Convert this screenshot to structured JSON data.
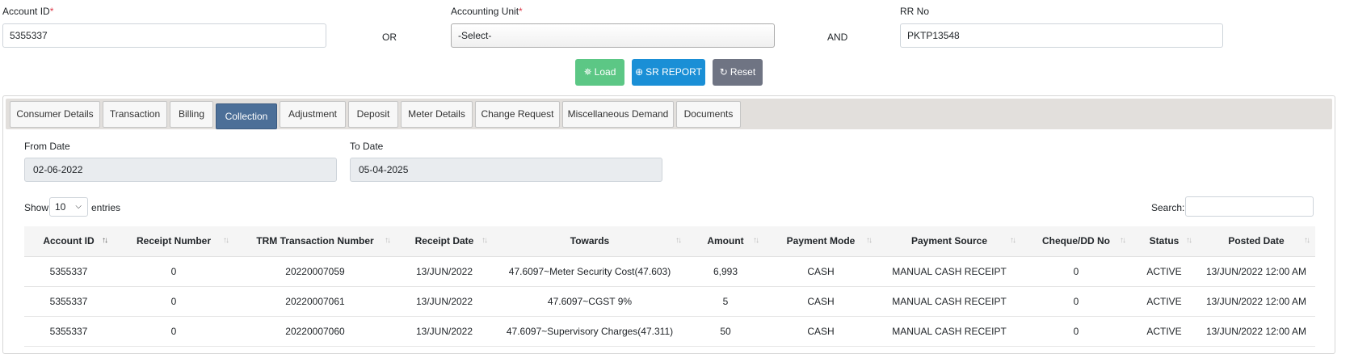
{
  "filters": {
    "account_id_label": "Account ID",
    "account_id_value": "5355337",
    "or_label": "OR",
    "accounting_unit_label": "Accounting Unit",
    "accounting_unit_value": "-Select-",
    "and_label": "AND",
    "rr_no_label": "RR No",
    "rr_no_value": "PKTP13548",
    "required_mark": "*"
  },
  "buttons": {
    "load": "Load",
    "sr_report": "SR REPORT",
    "reset": "Reset"
  },
  "tabs": [
    {
      "label": "Consumer Details"
    },
    {
      "label": "Transaction"
    },
    {
      "label": "Billing"
    },
    {
      "label": "Collection"
    },
    {
      "label": "Adjustment"
    },
    {
      "label": "Deposit"
    },
    {
      "label": "Meter Details"
    },
    {
      "label": "Change Request"
    },
    {
      "label": "Miscellaneous Demand"
    },
    {
      "label": "Documents"
    }
  ],
  "active_tab": "Collection",
  "dates": {
    "from_label": "From Date",
    "from_value": "02-06-2022",
    "to_label": "To Date",
    "to_value": "05-04-2025"
  },
  "table_controls": {
    "show_label": "Show",
    "entries_value": "10",
    "entries_label": "entries",
    "search_label": "Search:"
  },
  "table": {
    "columns": [
      "Account ID",
      "Receipt Number",
      "TRM Transaction Number",
      "Receipt Date",
      "Towards",
      "Amount",
      "Payment Mode",
      "Payment Source",
      "Cheque/DD No",
      "Status",
      "Posted Date"
    ],
    "rows": [
      [
        "5355337",
        "0",
        "20220007059",
        "13/JUN/2022",
        "47.6097~Meter Security Cost(47.603)",
        "6,993",
        "CASH",
        "MANUAL CASH RECEIPT",
        "0",
        "ACTIVE",
        "13/JUN/2022 12:00 AM"
      ],
      [
        "5355337",
        "0",
        "20220007061",
        "13/JUN/2022",
        "47.6097~CGST 9%",
        "5",
        "CASH",
        "MANUAL CASH RECEIPT",
        "0",
        "ACTIVE",
        "13/JUN/2022 12:00 AM"
      ],
      [
        "5355337",
        "0",
        "20220007060",
        "13/JUN/2022",
        "47.6097~Supervisory Charges(47.311)",
        "50",
        "CASH",
        "MANUAL CASH RECEIPT",
        "0",
        "ACTIVE",
        "13/JUN/2022 12:00 AM"
      ]
    ]
  },
  "colors": {
    "load_button": "#5cc785",
    "sr_report_button": "#1a8fd6",
    "reset_button": "#6f7483",
    "active_tab": "#4c6f98",
    "required": "#dc3545"
  }
}
